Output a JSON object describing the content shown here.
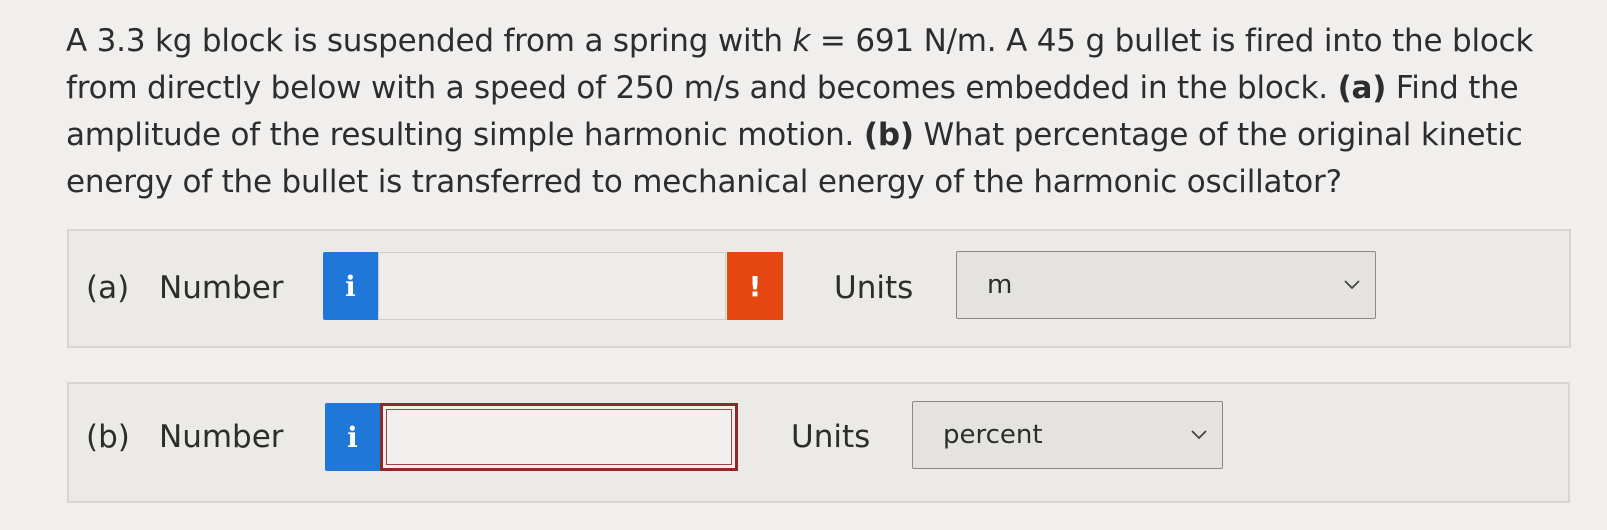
{
  "question": {
    "s1": "A 3.3 kg block is suspended from a spring with ",
    "k_symbol": "k",
    "s2": " = 691 N/m. A 45 g bullet is fired into the block from directly below with a speed of 250 m/s and becomes embedded in the block. ",
    "part_a_tag": "(a)",
    "s3": " Find the amplitude of the resulting simple harmonic motion. ",
    "part_b_tag": "(b)",
    "s4": " What percentage of the original kinetic energy of the bullet is transferred to mechanical energy of the harmonic oscillator?"
  },
  "part_a": {
    "label": "(a)",
    "number_label": "Number",
    "info_icon": "i",
    "number_value": "",
    "warning_icon": "!",
    "units_label": "Units",
    "units_value": "m"
  },
  "part_b": {
    "label": "(b)",
    "number_label": "Number",
    "info_icon": "i",
    "number_value": "",
    "units_label": "Units",
    "units_value": "percent"
  },
  "colors": {
    "info_button": "#1f78d8",
    "warning_button": "#e4470f",
    "invalid_border": "#8a2a2a"
  }
}
